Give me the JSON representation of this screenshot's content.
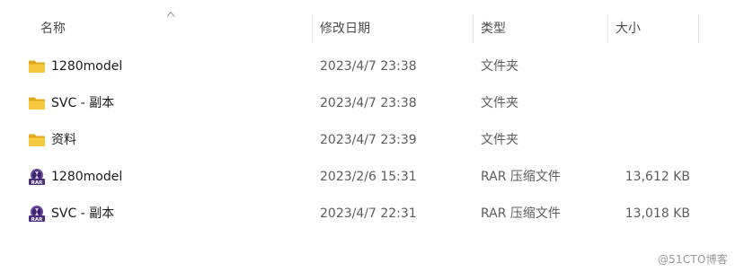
{
  "columns": {
    "name": "名称",
    "modified": "修改日期",
    "type": "类型",
    "size": "大小"
  },
  "sort": {
    "column": "name",
    "direction": "ascending",
    "icon": "sort-up-icon"
  },
  "files": [
    {
      "icon": "folder-icon",
      "name": "1280model",
      "modified": "2023/4/7 23:38",
      "type": "文件夹",
      "size": ""
    },
    {
      "icon": "folder-icon",
      "name": "SVC - 副本",
      "modified": "2023/4/7 23:38",
      "type": "文件夹",
      "size": ""
    },
    {
      "icon": "folder-icon",
      "name": "资料",
      "modified": "2023/4/7 23:39",
      "type": "文件夹",
      "size": ""
    },
    {
      "icon": "rar-archive-icon",
      "name": "1280model",
      "modified": "2023/2/6 15:31",
      "type": "RAR 压缩文件",
      "size": "13,612 KB"
    },
    {
      "icon": "rar-archive-icon",
      "name": "SVC - 副本",
      "modified": "2023/4/7 22:31",
      "type": "RAR 压缩文件",
      "size": "13,018 KB"
    }
  ],
  "watermark": "@51CTO博客",
  "colors": {
    "folder": "#f4c542",
    "folder_dark": "#e0a91c",
    "rar_badge": "#5b3b8c",
    "separator": "#e6e6e6"
  }
}
